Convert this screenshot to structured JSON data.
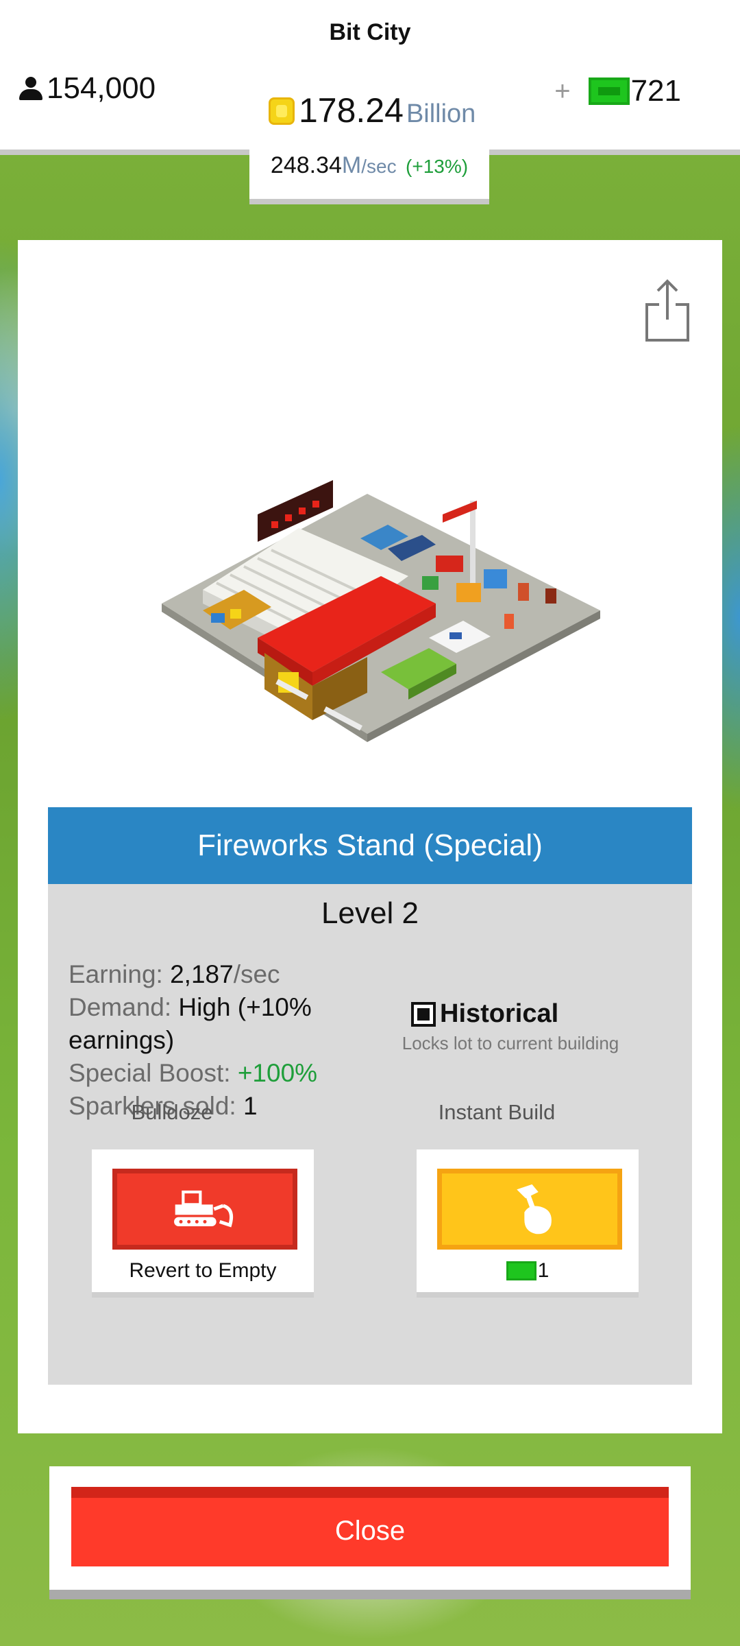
{
  "header": {
    "app_title": "Bit City",
    "population": "154,000",
    "money_value": "178.24",
    "money_unit": "Billion",
    "cash": "721",
    "plus_label": "+"
  },
  "rate": {
    "value": "248.34",
    "unit": "M",
    "per": "/sec",
    "change": "(+13%)"
  },
  "building": {
    "title": "Fireworks Stand (Special)",
    "level": "Level 2",
    "stats": {
      "earning_label": "Earning:",
      "earning_value": "2,187",
      "earning_unit": "/sec",
      "demand_label": "Demand:",
      "demand_value": "High (+10% earnings)",
      "boost_label": "Special Boost:",
      "boost_value": "+100%",
      "sold_label": "Sparklers sold:",
      "sold_value": "1"
    },
    "historical_label": "Historical",
    "historical_desc": "Locks lot to current building"
  },
  "actions": {
    "bulldoze_label": "Bulldoze",
    "bulldoze_caption": "Revert to Empty",
    "instant_label": "Instant Build",
    "instant_cost": "1"
  },
  "close_label": "Close",
  "colors": {
    "header_blue": "#2a86c4",
    "bulldoze_red": "#f03a2a",
    "instant_yellow": "#ffc51a",
    "close_red": "#ff3a2a",
    "positive_green": "#1e9e3a"
  }
}
